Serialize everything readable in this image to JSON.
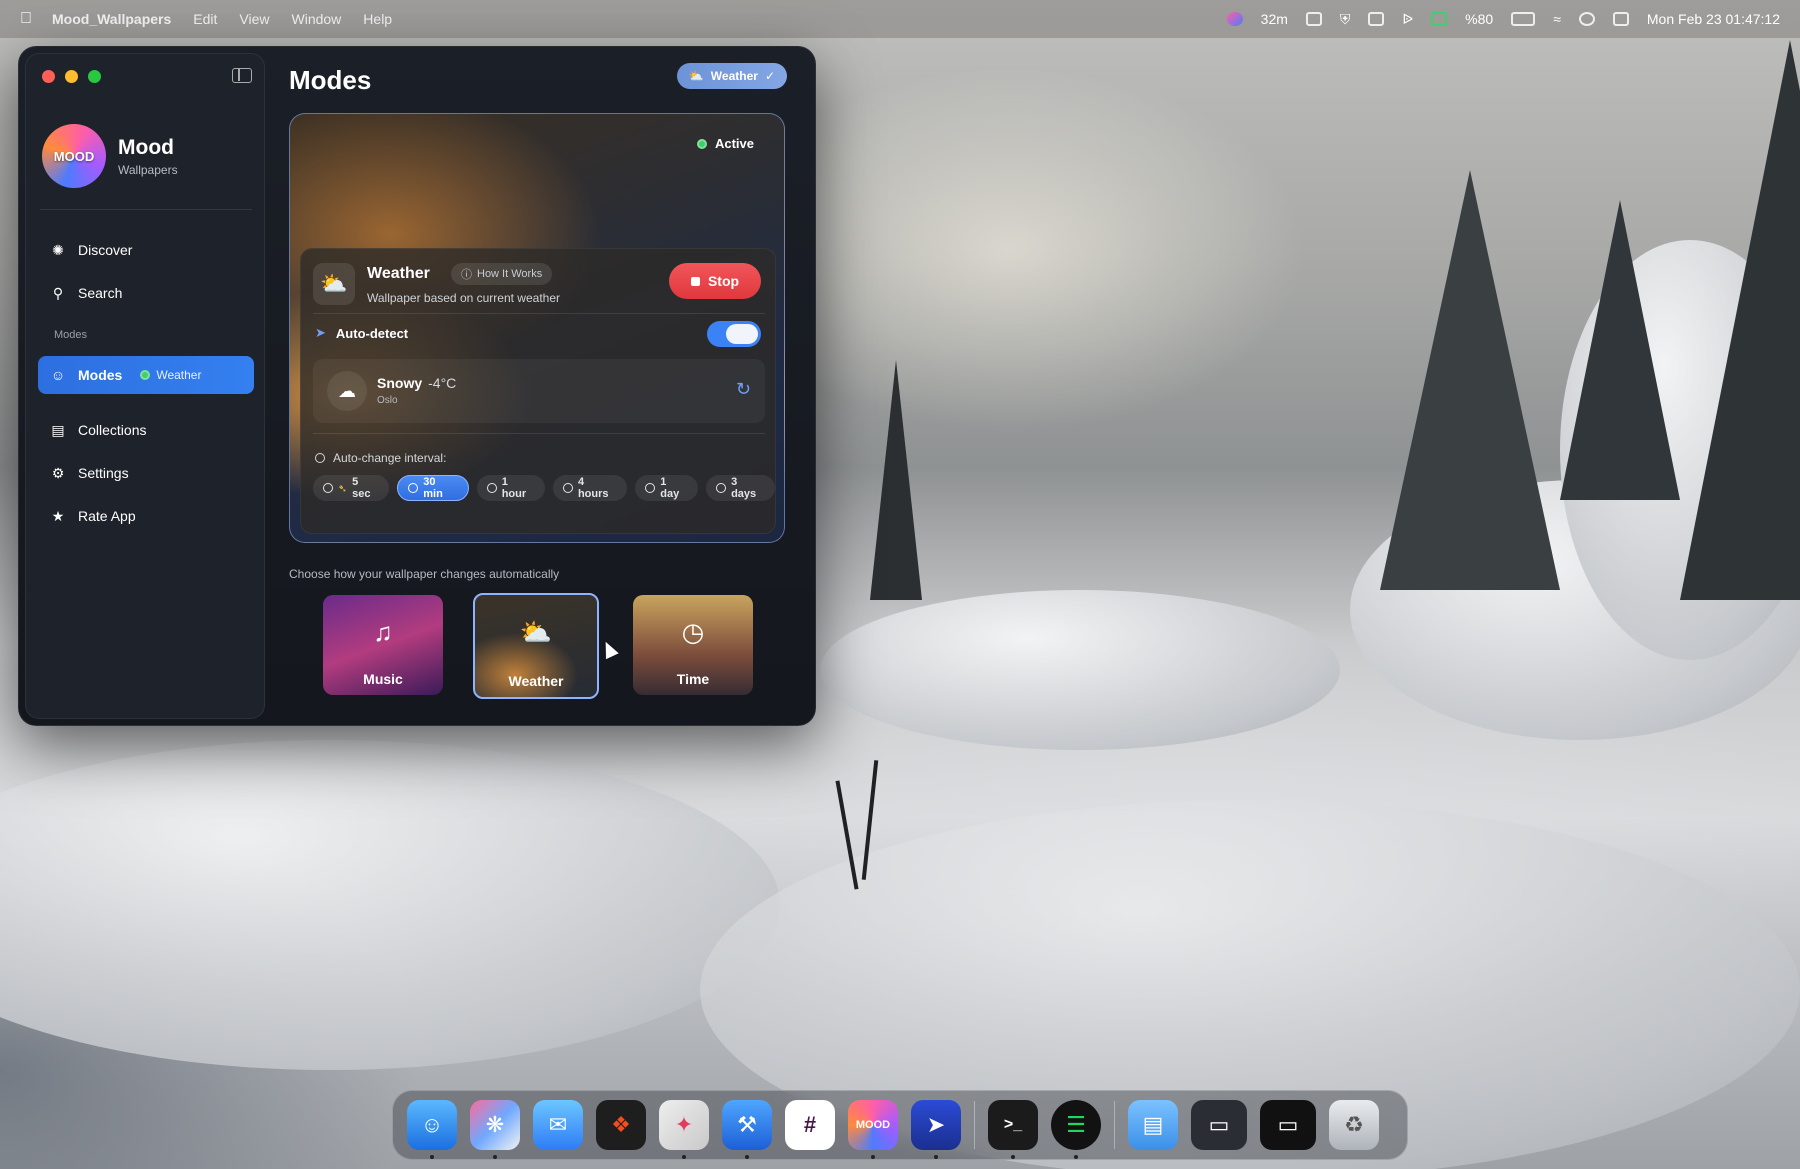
{
  "menubar": {
    "app_name": "Mood_Wallpapers",
    "menus": [
      "Edit",
      "View",
      "Window",
      "Help"
    ],
    "timer": "32m",
    "battery": "%80",
    "datetime": "Mon Feb 23  01:47:12"
  },
  "sidebar": {
    "brand_title": "Mood",
    "brand_subtitle": "Wallpapers",
    "logo_text": "MOOD",
    "items": [
      {
        "label": "Discover",
        "icon": "compass-icon"
      },
      {
        "label": "Search",
        "icon": "search-icon"
      }
    ],
    "section_label": "Modes",
    "active_item": {
      "label": "Modes",
      "badge": "Weather"
    },
    "items_bottom": [
      {
        "label": "Collections",
        "icon": "folder-icon"
      },
      {
        "label": "Settings",
        "icon": "gear-icon"
      },
      {
        "label": "Rate App",
        "icon": "star-icon"
      }
    ]
  },
  "main": {
    "title": "Modes",
    "header_pill": "Weather",
    "card": {
      "status": "Active",
      "mode_title": "Weather",
      "how_it_works": "How It Works",
      "subtitle": "Wallpaper based on current weather",
      "stop_label": "Stop",
      "auto_detect_label": "Auto-detect",
      "auto_detect_on": true,
      "weather_condition": "Snowy",
      "weather_temp": "-4°C",
      "weather_city": "Oslo",
      "interval_label": "Auto-change interval:",
      "intervals": [
        "5 sec",
        "30 min",
        "1 hour",
        "4 hours",
        "1 day",
        "3 days"
      ],
      "selected_interval": "30 min"
    },
    "hint": "Choose how your wallpaper changes automatically",
    "mode_tiles": [
      "Music",
      "Weather",
      "Time"
    ],
    "selected_mode": "Weather"
  },
  "dock": {
    "apps": [
      "Finder",
      "Launchpad",
      "Mail",
      "Figma",
      "Pixelmator",
      "Xcode",
      "Slack",
      "Mood Wallpapers",
      "Proxyman",
      "Terminal",
      "Spotify",
      "Downloads",
      "Screenshot Preview",
      "Window Preview",
      "Trash"
    ]
  },
  "colors": {
    "accent": "#3480f0",
    "stop": "#e0383d",
    "active_dot": "#3fd06b"
  }
}
